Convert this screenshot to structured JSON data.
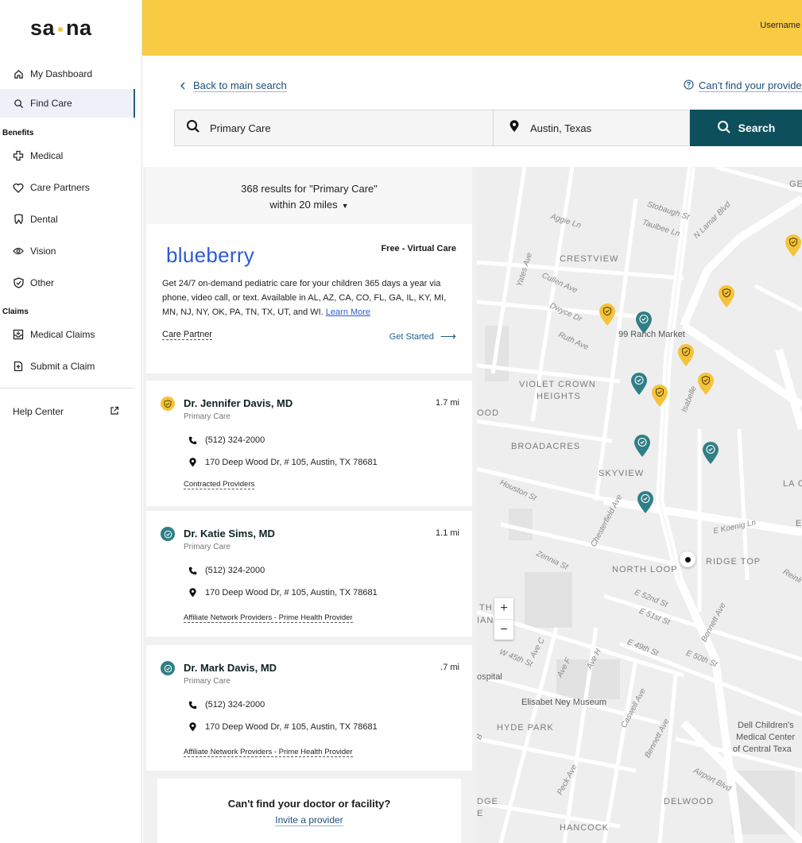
{
  "brand": {
    "logo_left": "sa",
    "logo_right": "na"
  },
  "sidebar": {
    "items": [
      {
        "label": "My Dashboard"
      },
      {
        "label": "Find Care"
      },
      {
        "label": "Medical"
      },
      {
        "label": "Care Partners"
      },
      {
        "label": "Dental"
      },
      {
        "label": "Vision"
      },
      {
        "label": "Other"
      },
      {
        "label": "Medical Claims"
      },
      {
        "label": "Submit a Claim"
      },
      {
        "label": "Help Center"
      }
    ],
    "sections": {
      "benefits": "Benefits",
      "claims": "Claims"
    }
  },
  "topbar": {
    "username": "Username"
  },
  "search": {
    "back_label": "Back to main search",
    "cant_find_label": "Can't find your provide",
    "query_value": "Primary Care",
    "location_value": "Austin, Texas",
    "button_label": "Search"
  },
  "results": {
    "count_text": "368 results for \"Primary Care\"",
    "radius_text": "within 20 miles",
    "promo": {
      "brand": "blueberry",
      "tag": "Free - Virtual Care",
      "description": "Get 24/7 on-demand pediatric care for your children 365 days a year via phone, video call, or text. Available in AL, AZ, CA, CO, FL, GA, IL, KY, MI, MN, NJ, NY, OK, PA, TN, TX, UT, and WI.",
      "learn_more": "Learn More",
      "category": "Care Partner",
      "cta": "Get Started"
    },
    "providers": [
      {
        "name": "Dr. Jennifer Davis, MD",
        "specialty": "Primary Care",
        "distance": "1.7 mi",
        "phone": "(512) 324-2000",
        "address": "170 Deep Wood Dr, # 105, Austin, TX 78681",
        "network": "Contracted Providers"
      },
      {
        "name": "Dr. Katie Sims, MD",
        "specialty": "Primary Care",
        "distance": "1.1 mi",
        "phone": "(512) 324-2000",
        "address": "170 Deep Wood Dr, # 105, Austin, TX 78681",
        "network": "Affiliate Network Providers - Prime Health Provider"
      },
      {
        "name": "Dr. Mark Davis, MD",
        "specialty": "Primary Care",
        "distance": ".7 mi",
        "phone": "(512) 324-2000",
        "address": "170 Deep Wood Dr, # 105, Austin, TX 78681",
        "network": "Affiliate Network Providers - Prime Health Provider"
      }
    ],
    "invite": {
      "question": "Can't find your doctor or facility?",
      "link": "Invite a provider"
    }
  },
  "map": {
    "zoom_in": "+",
    "zoom_out": "−",
    "labels": {
      "crestview": "CRESTVIEW",
      "violet_crown_1": "VIOLET CROWN",
      "violet_crown_2": "HEIGHTS",
      "broadacres": "BROADACRES",
      "skyview": "SKYVIEW",
      "north_loop": "NORTH LOOP",
      "ridge_top": "RIDGE TOP",
      "hyde_park": "HYDE PARK",
      "delwood": "DELWOOD",
      "hancock": "HANCOCK",
      "ranch_market": "99 Ranch Market",
      "ney_museum": "Elisabet Ney Museum",
      "dell_1": "Dell Children's",
      "dell_2": "Medical Center",
      "dell_3": "of Central Texa",
      "ospital": "ospital",
      "aggie": "Aggie Ln",
      "stobaugh": "Stobaugh St",
      "taulbee": "Taulbee Ln",
      "lamar": "N Lamar Blvd",
      "yates": "Yates Ave",
      "cullen": "Cullen Ave",
      "dwyce": "Dwyce Dr",
      "ruth": "Ruth Ave",
      "houston": "Houston St",
      "chesterfield": "Chesterfield Ave",
      "koenig": "E Koenig Ln",
      "zennia": "Zennia St",
      "e52": "E 52nd St",
      "e51": "E 51st St",
      "e49": "E 49th St",
      "e50": "E 50th St",
      "bennett": "Bennett Ave",
      "w45": "W 45th St",
      "avef": "Ave F",
      "aveh": "Ave H",
      "avec": "Ave C",
      "caswell": "Caswell Ave",
      "peck": "Peck Ave",
      "airport": "Airport Blvd",
      "isabelle": "Isabelle",
      "ood": "OOD",
      "ge": "GE",
      "lac": "LA C",
      "e_right": "E",
      "reinli": "Reinli",
      "th_left": "TH",
      "ian_left": "IAN",
      "dge": "DGE",
      "e_left": "E",
      "b_left": "B"
    },
    "colors": {
      "contracted": "#f5c33b",
      "affiliate": "#2f7f86"
    }
  }
}
